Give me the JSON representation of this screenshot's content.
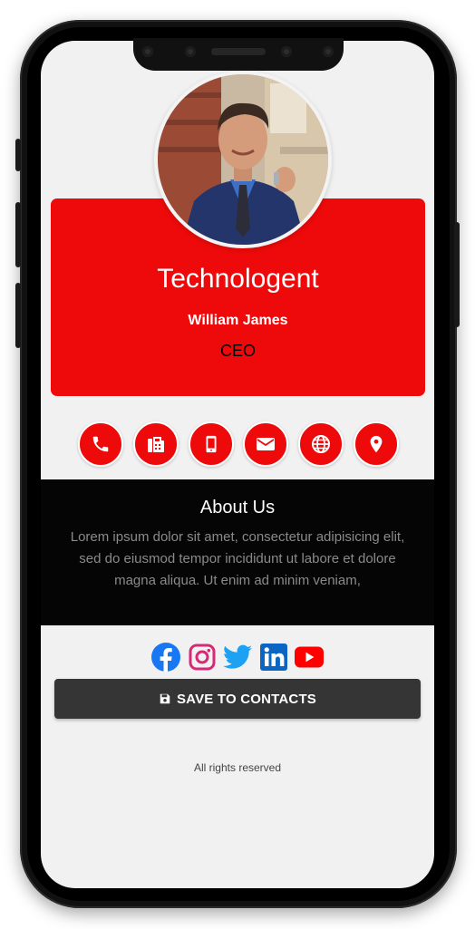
{
  "profile": {
    "company": "Technologent",
    "name": "William James",
    "title": "CEO"
  },
  "actions": [
    {
      "icon": "phone-icon"
    },
    {
      "icon": "fax-icon"
    },
    {
      "icon": "mobile-icon"
    },
    {
      "icon": "email-icon"
    },
    {
      "icon": "website-icon"
    },
    {
      "icon": "location-icon"
    }
  ],
  "about": {
    "heading": "About Us",
    "text": "Lorem ipsum dolor sit amet, consectetur adipisicing elit, sed do eiusmod tempor incididunt ut labore et dolore magna aliqua. Ut enim ad minim veniam,"
  },
  "social": [
    {
      "icon": "facebook-icon",
      "color": "#1877f2"
    },
    {
      "icon": "instagram-icon",
      "color": "#d62976"
    },
    {
      "icon": "twitter-icon",
      "color": "#1da1f2"
    },
    {
      "icon": "linkedin-icon",
      "color": "#0a66c2"
    },
    {
      "icon": "youtube-icon",
      "color": "#ff0000"
    }
  ],
  "save_button": {
    "label": "SAVE TO CONTACTS",
    "icon": "floppy-disk-icon"
  },
  "footer": {
    "text": "All rights reserved"
  },
  "colors": {
    "accent": "#ee0a0a",
    "about_bg": "#050505",
    "button_bg": "#353535",
    "page_bg": "#f1f1f1"
  }
}
